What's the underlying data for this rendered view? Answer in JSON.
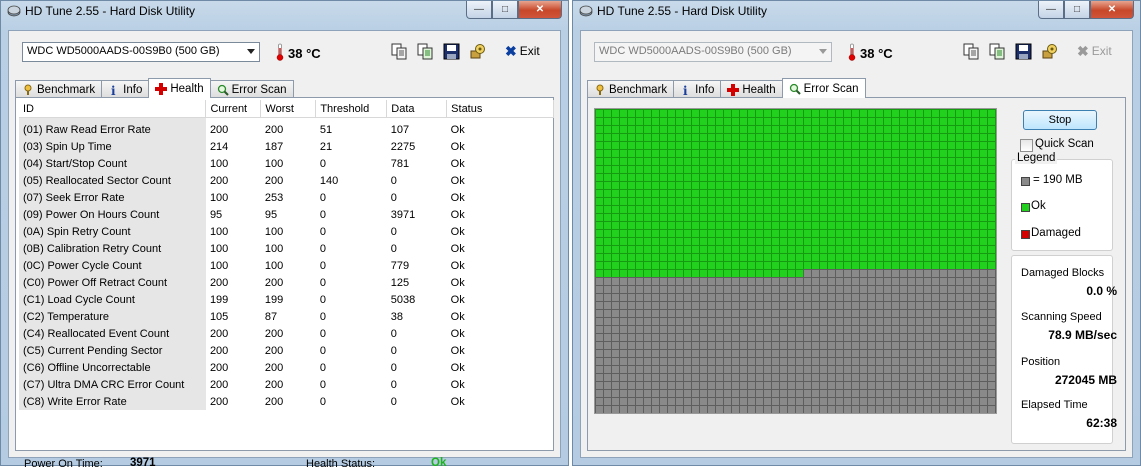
{
  "left_window": {
    "title": "HD Tune 2.55 - Hard Disk Utility",
    "drive": "WDC WD5000AADS-00S9B0 (500 GB)",
    "temperature": "38 °C",
    "exit_label": "Exit",
    "tabs": [
      {
        "label": "Benchmark",
        "icon": "benchmark-icon"
      },
      {
        "label": "Info",
        "icon": "info-icon"
      },
      {
        "label": "Health",
        "icon": "health-icon"
      },
      {
        "label": "Error Scan",
        "icon": "error-scan-icon"
      }
    ],
    "active_tab": "Health",
    "health": {
      "columns": [
        "ID",
        "Current",
        "Worst",
        "Threshold",
        "Data",
        "Status"
      ],
      "rows": [
        [
          "(01) Raw Read Error Rate",
          "200",
          "200",
          "51",
          "107",
          "Ok"
        ],
        [
          "(03) Spin Up Time",
          "214",
          "187",
          "21",
          "2275",
          "Ok"
        ],
        [
          "(04) Start/Stop Count",
          "100",
          "100",
          "0",
          "781",
          "Ok"
        ],
        [
          "(05) Reallocated Sector Count",
          "200",
          "200",
          "140",
          "0",
          "Ok"
        ],
        [
          "(07) Seek Error Rate",
          "100",
          "253",
          "0",
          "0",
          "Ok"
        ],
        [
          "(09) Power On Hours Count",
          "95",
          "95",
          "0",
          "3971",
          "Ok"
        ],
        [
          "(0A) Spin Retry Count",
          "100",
          "100",
          "0",
          "0",
          "Ok"
        ],
        [
          "(0B) Calibration Retry Count",
          "100",
          "100",
          "0",
          "0",
          "Ok"
        ],
        [
          "(0C) Power Cycle Count",
          "100",
          "100",
          "0",
          "779",
          "Ok"
        ],
        [
          "(C0) Power Off Retract Count",
          "200",
          "200",
          "0",
          "125",
          "Ok"
        ],
        [
          "(C1) Load Cycle Count",
          "199",
          "199",
          "0",
          "5038",
          "Ok"
        ],
        [
          "(C2) Temperature",
          "105",
          "87",
          "0",
          "38",
          "Ok"
        ],
        [
          "(C4) Reallocated Event Count",
          "200",
          "200",
          "0",
          "0",
          "Ok"
        ],
        [
          "(C5) Current Pending Sector",
          "200",
          "200",
          "0",
          "0",
          "Ok"
        ],
        [
          "(C6) Offline Uncorrectable",
          "200",
          "200",
          "0",
          "0",
          "Ok"
        ],
        [
          "(C7) Ultra DMA CRC Error Count",
          "200",
          "200",
          "0",
          "0",
          "Ok"
        ],
        [
          "(C8) Write Error Rate",
          "200",
          "200",
          "0",
          "0",
          "Ok"
        ]
      ],
      "power_on_label": "Power On Time:",
      "power_on_value": "3971",
      "health_status_label": "Health Status:",
      "health_status_value": "Ok"
    }
  },
  "right_window": {
    "title": "HD Tune 2.55 - Hard Disk Utility",
    "drive": "WDC WD5000AADS-00S9B0 (500 GB)",
    "temperature": "38 °C",
    "exit_label": "Exit",
    "tabs": [
      {
        "label": "Benchmark",
        "icon": "benchmark-icon"
      },
      {
        "label": "Info",
        "icon": "info-icon"
      },
      {
        "label": "Health",
        "icon": "health-icon"
      },
      {
        "label": "Error Scan",
        "icon": "error-scan-icon"
      }
    ],
    "active_tab": "Error Scan",
    "scan": {
      "scanned_fraction": 0.53,
      "stop_label": "Stop",
      "quick_scan_label": "Quick Scan",
      "quick_scan_checked": false,
      "legend_title": "Legend",
      "legend_block": "= 190 MB",
      "legend_ok": "Ok",
      "legend_damaged": "Damaged",
      "damaged_label": "Damaged Blocks",
      "damaged_value": "0.0 %",
      "speed_label": "Scanning Speed",
      "speed_value": "78.9 MB/sec",
      "position_label": "Position",
      "position_value": "272045 MB",
      "elapsed_label": "Elapsed Time",
      "elapsed_value": "62:38"
    }
  },
  "colors": {
    "ok_green": "#22d11e",
    "damaged_red": "#d40000",
    "untested_grey": "#8a8a8a",
    "health_ok_text": "#1bb51b"
  }
}
